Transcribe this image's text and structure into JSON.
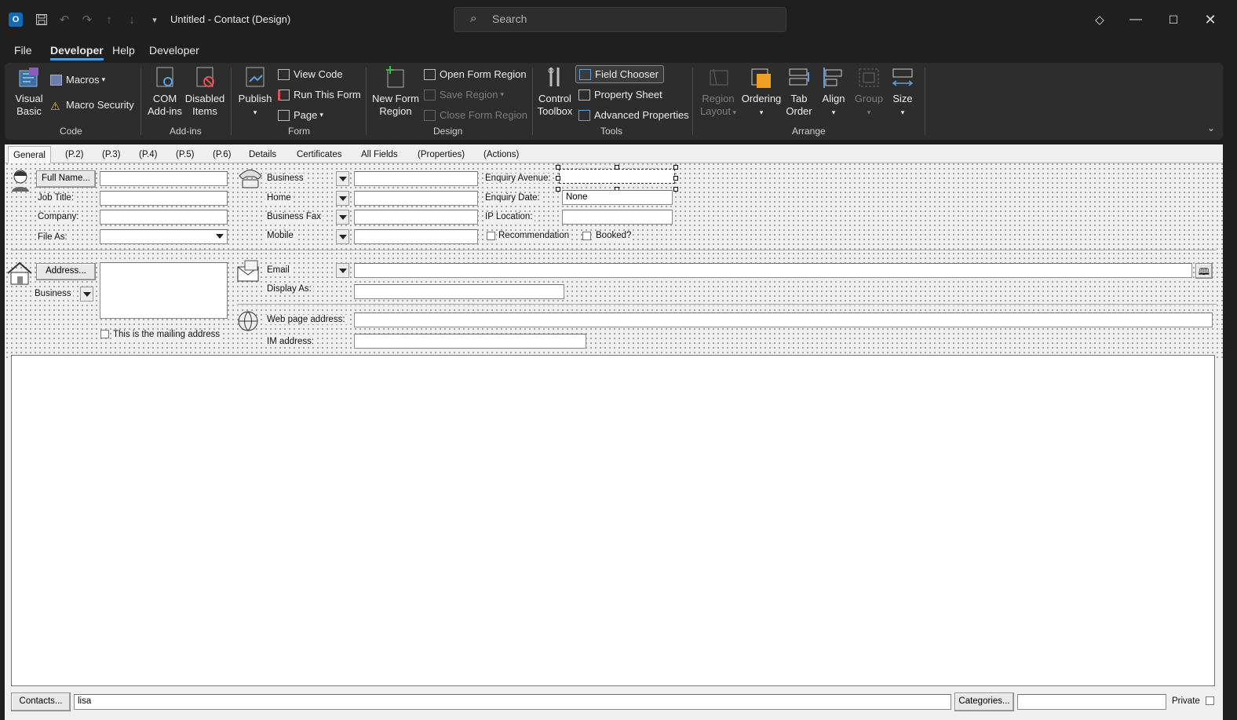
{
  "window": {
    "title": "Untitled  -  Contact  (Design)",
    "search_placeholder": "Search",
    "app_icon_letter": "O"
  },
  "menu": [
    "File",
    "Developer",
    "Help",
    "Developer"
  ],
  "ribbon": {
    "code": {
      "label": "Code",
      "visual_basic": [
        "Visual",
        "Basic"
      ],
      "macros": "Macros",
      "macro_security": "Macro Security"
    },
    "addins": {
      "label": "Add-ins",
      "com": [
        "COM",
        "Add-ins"
      ],
      "disabled": [
        "Disabled",
        "Items"
      ]
    },
    "form": {
      "label": "Form",
      "publish": "Publish",
      "view_code": "View Code",
      "run_this_form": "Run This Form",
      "page": "Page"
    },
    "design": {
      "label": "Design",
      "new_form_region": [
        "New Form",
        "Region"
      ],
      "open_form_region": "Open Form Region",
      "save_region": "Save Region",
      "close_form_region": "Close Form Region"
    },
    "tools": {
      "label": "Tools",
      "control_toolbox": [
        "Control",
        "Toolbox"
      ],
      "field_chooser": "Field Chooser",
      "property_sheet": "Property Sheet",
      "advanced_properties": "Advanced Properties"
    },
    "arrange": {
      "label": "Arrange",
      "region_layout": [
        "Region",
        "Layout"
      ],
      "ordering": "Ordering",
      "tab_order": [
        "Tab",
        "Order"
      ],
      "align": "Align",
      "group": "Group",
      "size": "Size"
    }
  },
  "form_tabs": [
    "General",
    "(P.2)",
    "(P.3)",
    "(P.4)",
    "(P.5)",
    "(P.6)",
    "Details",
    "Certificates",
    "All Fields",
    "(Properties)",
    "(Actions)"
  ],
  "general": {
    "full_name_btn": "Full Name...",
    "job_title": "Job Title:",
    "company": "Company:",
    "file_as": "File As:",
    "phones": [
      "Business",
      "Home",
      "Business Fax",
      "Mobile"
    ],
    "enquiry_avenue": "Enquiry Avenue:",
    "enquiry_date": "Enquiry Date:",
    "enquiry_date_value": "None",
    "ip_location": "IP Location:",
    "recommendation": "Recommendation",
    "booked": "Booked?",
    "address_btn": "Address...",
    "address_type": "Business",
    "mailing_address": "This is the mailing address",
    "email": "Email",
    "display_as": "Display As:",
    "web_page": "Web page address:",
    "im_address": "IM address:"
  },
  "footer": {
    "contacts_btn": "Contacts...",
    "contacts_value": "lisa",
    "categories_btn": "Categories...",
    "private": "Private"
  }
}
